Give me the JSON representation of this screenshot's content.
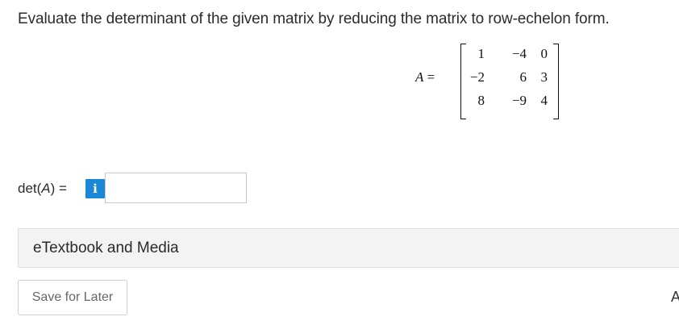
{
  "question": {
    "prompt": "Evaluate the determinant of the given matrix by reducing the matrix to row-echelon form."
  },
  "matrix": {
    "name": "A",
    "equals": "=",
    "rows": [
      [
        "1",
        "−4",
        "0"
      ],
      [
        "−2",
        "6",
        "3"
      ],
      [
        "8",
        "−9",
        "4"
      ]
    ]
  },
  "answer": {
    "label_fn": "det(",
    "label_var": "A",
    "label_close": ") =",
    "info_icon_text": "i",
    "value": "",
    "placeholder": ""
  },
  "resources": {
    "etextbook_label": "eTextbook and Media"
  },
  "actions": {
    "save_label": "Save for Later",
    "attempts_glyph": "A"
  },
  "colors": {
    "info_button": "#1a87d8",
    "panel_background": "#f3f3f3"
  }
}
